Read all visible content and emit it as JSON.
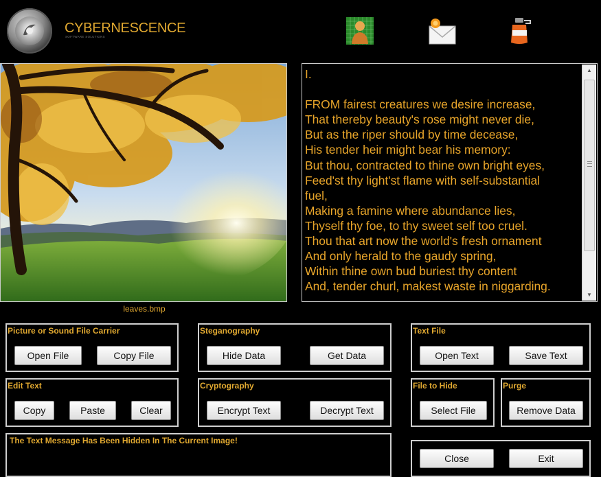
{
  "header": {
    "brand": "CYBERNESCENCE",
    "tagline": "SOFTWARE SOLUTIONS",
    "icons": [
      "person-grid-icon",
      "mail-icon",
      "bottle-icon"
    ]
  },
  "picture": {
    "filename": "leaves.bmp"
  },
  "text_area": {
    "content": "I.\n\nFROM fairest creatures we desire increase,\nThat thereby beauty's rose might never die,\nBut as the riper should by time decease,\nHis tender heir might bear his memory:\nBut thou, contracted to thine own bright eyes,\nFeed'st thy light'st flame with self-substantial\nfuel,\nMaking a famine where abundance lies,\nThyself thy foe, to thy sweet self too cruel.\nThou that art now the world's fresh ornament\nAnd only herald to the gaudy spring,\nWithin thine own bud buriest thy content\nAnd, tender churl, makest waste in niggarding."
  },
  "groups": {
    "carrier": {
      "title": "Picture or Sound File Carrier",
      "open_label": "Open File",
      "copy_label": "Copy File"
    },
    "stego": {
      "title": "Steganography",
      "hide_label": "Hide Data",
      "get_label": "Get Data"
    },
    "textfile": {
      "title": "Text File",
      "open_label": "Open Text",
      "save_label": "Save Text"
    },
    "edit": {
      "title": "Edit Text",
      "copy_label": "Copy",
      "paste_label": "Paste",
      "clear_label": "Clear"
    },
    "crypto": {
      "title": "Cryptography",
      "encrypt_label": "Encrypt Text",
      "decrypt_label": "Decrypt Text"
    },
    "filehide": {
      "title": "File to Hide",
      "select_label": "Select File"
    },
    "purge": {
      "title": "Purge",
      "remove_label": "Remove Data"
    },
    "window": {
      "close_label": "Close",
      "exit_label": "Exit"
    }
  },
  "status": {
    "message": "The Text Message Has Been Hidden In The Current Image!"
  },
  "colors": {
    "accent": "#e0a830",
    "background": "#000000"
  }
}
